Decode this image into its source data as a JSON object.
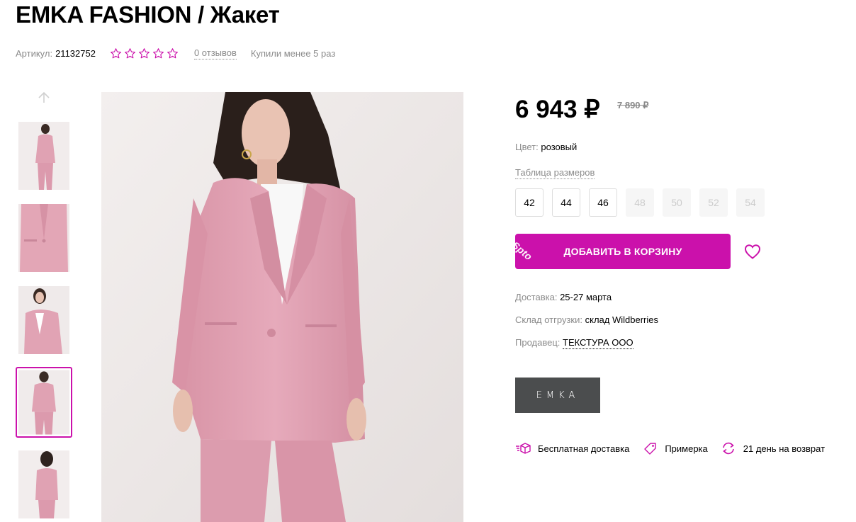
{
  "product": {
    "title": "EMKA FASHION / Жакет",
    "article_label": "Артикул:",
    "article_value": "21132752",
    "rating_stars": 5,
    "reviews": "0 отзывов",
    "bought": "Купили менее 5 раз"
  },
  "gallery": {
    "thumbnails": [
      "thumbnail-1",
      "thumbnail-2",
      "thumbnail-3",
      "thumbnail-4",
      "thumbnail-5"
    ],
    "selected_index": 3
  },
  "price": {
    "current": "6 943 ₽",
    "old": "7 890 ₽"
  },
  "color": {
    "label": "Цвет:",
    "value": "розовый"
  },
  "size_table_link": "Таблица размеров",
  "sizes": [
    {
      "label": "42",
      "available": true
    },
    {
      "label": "44",
      "available": true
    },
    {
      "label": "46",
      "available": true
    },
    {
      "label": "48",
      "available": false
    },
    {
      "label": "50",
      "available": false
    },
    {
      "label": "52",
      "available": false
    },
    {
      "label": "54",
      "available": false
    }
  ],
  "cart": {
    "button_label": "ДОБАВИТЬ В КОРЗИНУ",
    "badge": "Spto"
  },
  "delivery": {
    "label": "Доставка:",
    "value": "25-27 марта"
  },
  "warehouse": {
    "label": "Склад отгрузки:",
    "value": "склад Wildberries"
  },
  "seller": {
    "label": "Продавец:",
    "value": "ТЕКСТУРА ООО"
  },
  "brand_logo_text": "EMKA",
  "features": [
    {
      "icon": "box-delivery-icon",
      "label": "Бесплатная доставка"
    },
    {
      "icon": "tag-icon",
      "label": "Примерка"
    },
    {
      "icon": "return-arrows-icon",
      "label": "21 день на возврат"
    }
  ],
  "colors": {
    "accent": "#cb11ab",
    "suit_pink": "#e2a4b4",
    "logo_bg": "#4b4d4e"
  }
}
